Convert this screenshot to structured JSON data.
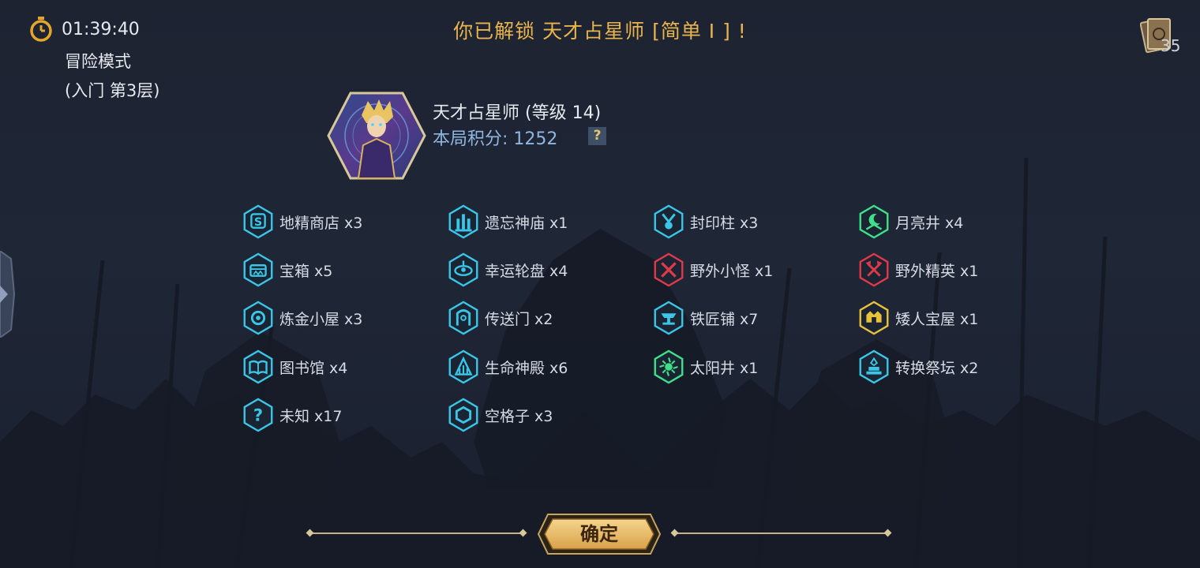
{
  "timer": {
    "time": "01:39:40",
    "icon": "stopwatch-icon"
  },
  "mode": {
    "line1": "冒险模式",
    "line2": "(入门 第3层)"
  },
  "title": "你已解锁 天才占星师 [简单 I ] !",
  "cards": {
    "icon": "card-deck-icon",
    "count": "35"
  },
  "hero": {
    "name": "天才占星师 (等级 14)",
    "score": "本局积分: 1252",
    "help": "?"
  },
  "items": [
    {
      "label": "地精商店 x3",
      "icon": "shop-icon",
      "color": "#3ac6e8"
    },
    {
      "label": "遗忘神庙 x1",
      "icon": "temple-icon",
      "color": "#3ac6e8"
    },
    {
      "label": "封印柱 x3",
      "icon": "seal-pillar-icon",
      "color": "#3ac6e8"
    },
    {
      "label": "月亮井 x4",
      "icon": "moon-well-icon",
      "color": "#3ee08a"
    },
    {
      "label": "宝箱 x5",
      "icon": "chest-icon",
      "color": "#3ac6e8"
    },
    {
      "label": "幸运轮盘 x4",
      "icon": "wheel-icon",
      "color": "#3ac6e8"
    },
    {
      "label": "野外小怪 x1",
      "icon": "crossed-swords-icon",
      "color": "#e0394a"
    },
    {
      "label": "野外精英 x1",
      "icon": "crossed-axes-icon",
      "color": "#e0394a"
    },
    {
      "label": "炼金小屋 x3",
      "icon": "alchemy-icon",
      "color": "#3ac6e8"
    },
    {
      "label": "传送门 x2",
      "icon": "portal-icon",
      "color": "#3ac6e8"
    },
    {
      "label": "铁匠铺 x7",
      "icon": "anvil-icon",
      "color": "#3ac6e8"
    },
    {
      "label": "矮人宝屋 x1",
      "icon": "dwarf-vault-icon",
      "color": "#e8c23a"
    },
    {
      "label": "图书馆 x4",
      "icon": "book-icon",
      "color": "#3ac6e8"
    },
    {
      "label": "生命神殿 x6",
      "icon": "life-shrine-icon",
      "color": "#3ac6e8"
    },
    {
      "label": "太阳井 x1",
      "icon": "sun-well-icon",
      "color": "#3ee08a"
    },
    {
      "label": "转换祭坛 x2",
      "icon": "altar-icon",
      "color": "#3ac6e8"
    },
    {
      "label": "未知 x17",
      "icon": "question-icon",
      "color": "#3ac6e8"
    },
    {
      "label": "空格子 x3",
      "icon": "hexagon-icon",
      "color": "#3ac6e8"
    }
  ],
  "confirm": "确定"
}
